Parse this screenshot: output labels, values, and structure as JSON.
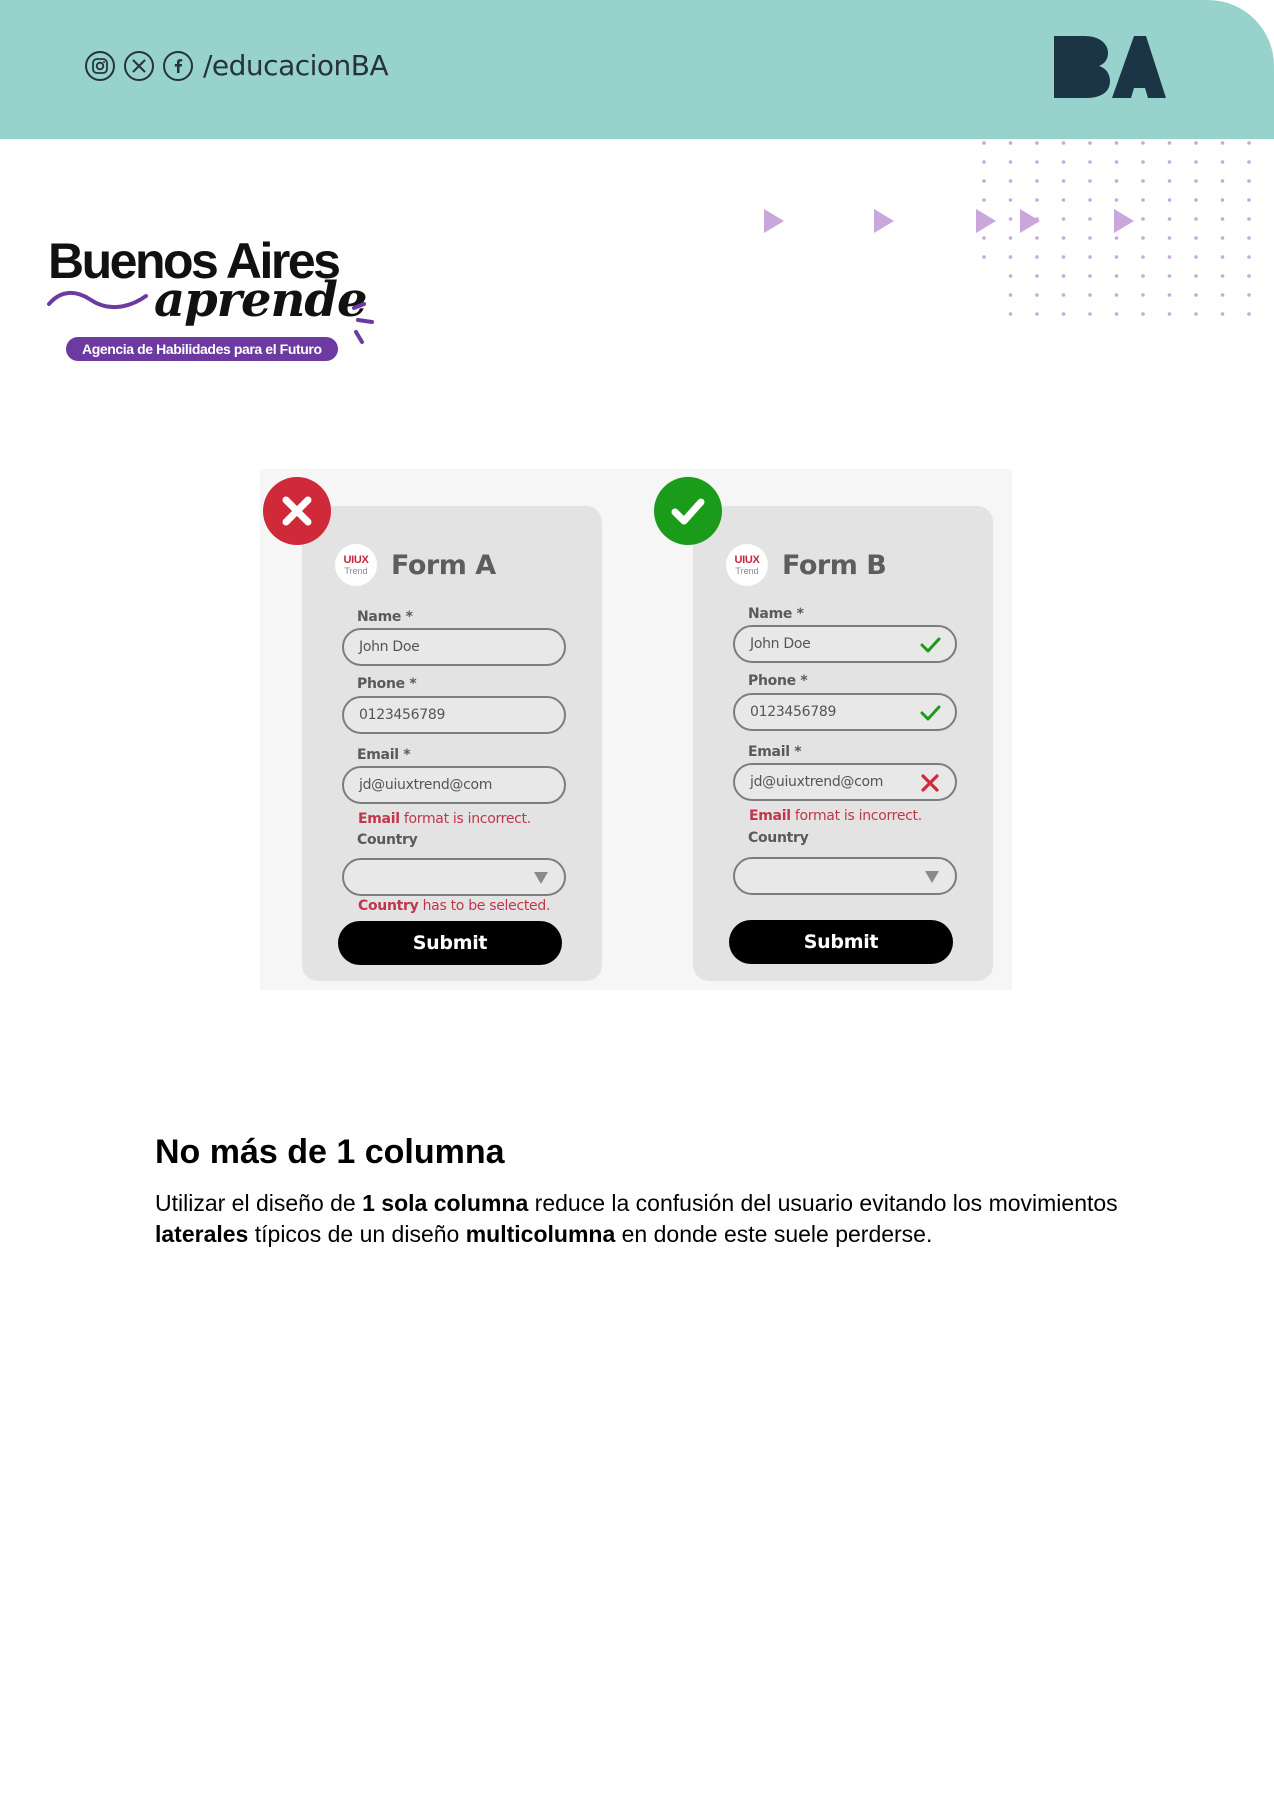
{
  "header": {
    "social_handle": "/educacionBA",
    "social_icons": [
      "instagram-icon",
      "x-icon",
      "facebook-icon"
    ],
    "band_color": "#98d2cd",
    "logo_text": "BA"
  },
  "brand": {
    "title": "Buenos Aires",
    "script": "aprende",
    "tagline": "Agencia de Habilidades para el Futuro",
    "accent_color": "#6c3aa0"
  },
  "figure": {
    "forms": [
      {
        "verdict": "incorrect",
        "logo_line1": "UIUX",
        "logo_line2": "Trend",
        "title": "Form A",
        "name_label": "Name *",
        "name_value": "John Doe",
        "phone_label": "Phone *",
        "phone_value": "0123456789",
        "email_label": "Email *",
        "email_value": "jd@uiuxtrend@com",
        "email_error_bold": "Email",
        "email_error_rest": " format is incorrect.",
        "country_label": "Country",
        "country_error_bold": "Country",
        "country_error_rest": " has to be selected.",
        "submit_label": "Submit"
      },
      {
        "verdict": "correct",
        "logo_line1": "UIUX",
        "logo_line2": "Trend",
        "title": "Form B",
        "name_label": "Name *",
        "name_value": "John Doe",
        "phone_label": "Phone *",
        "phone_value": "0123456789",
        "email_label": "Email *",
        "email_value": "jd@uiuxtrend@com",
        "email_error_bold": "Email",
        "email_error_rest": " format is incorrect.",
        "country_label": "Country",
        "submit_label": "Submit"
      }
    ]
  },
  "section": {
    "title": "No más de 1 columna",
    "p1": "Utilizar el diseño de ",
    "b1": "1 sola columna",
    "p2": " reduce la confusión del usuario evitando los movimientos ",
    "b2": "laterales",
    "p3": " típicos de un diseño ",
    "b3": "multicolumna",
    "p4": " en donde este suele perderse."
  }
}
